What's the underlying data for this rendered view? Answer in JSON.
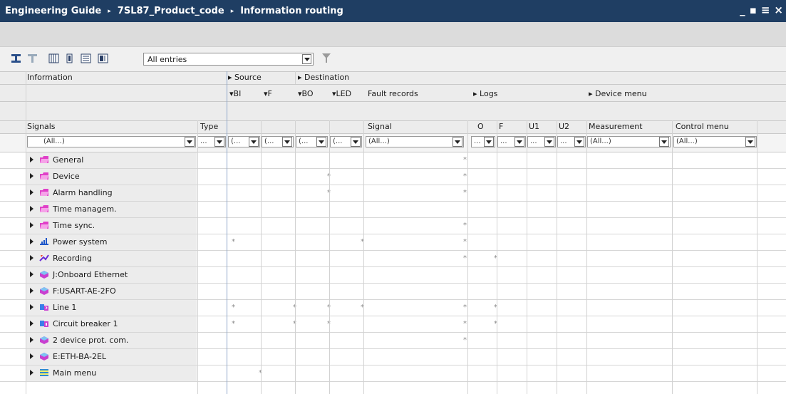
{
  "titlebar": {
    "crumbs": [
      "Engineering Guide",
      "7SL87_Product_code",
      "Information routing"
    ],
    "separator": "▸",
    "controls": [
      "_",
      "▪",
      "≡",
      "×"
    ]
  },
  "toolbar": {
    "buttons": [
      "insert-row-icon",
      "expand-icon",
      "columns-icon",
      "column-icon",
      "list-icon",
      "split-icon"
    ],
    "filter_value": "All entries",
    "filter_icon": "funnel-icon"
  },
  "header": {
    "information": "Information",
    "source": "Source",
    "destination": "Destination",
    "bi": "BI",
    "f": "F",
    "bo": "BO",
    "led": "LED",
    "fault_records": "Fault records",
    "logs": "Logs",
    "device_menu": "Device menu",
    "signals": "Signals",
    "type": "Type",
    "signal": "Signal",
    "o": "O",
    "f2": "F",
    "u1": "U1",
    "u2": "U2",
    "measurement": "Measurement",
    "control_menu": "Control menu"
  },
  "filters": {
    "signals": "(All...)",
    "type": "...",
    "bi": "(...",
    "f": "(...",
    "bo": "(...",
    "led": "(...",
    "signal": "(All...)",
    "o": "...",
    "f2": "...",
    "u1": "...",
    "u2": "...",
    "measurement": "(All...)",
    "control_menu": "(All...)"
  },
  "rows": [
    {
      "label": "General",
      "icon": "folder-pink-icon",
      "marks": {
        "o": "*"
      }
    },
    {
      "label": "Device",
      "icon": "folder-pink-icon",
      "marks": {
        "led": "*",
        "o": "*"
      }
    },
    {
      "label": "Alarm handling",
      "icon": "folder-pink-icon",
      "marks": {
        "led": "*",
        "o": "*"
      }
    },
    {
      "label": "Time managem.",
      "icon": "folder-pink-icon",
      "marks": {}
    },
    {
      "label": "Time sync.",
      "icon": "folder-pink-icon",
      "marks": {
        "o": "*"
      }
    },
    {
      "label": "Power system",
      "icon": "power-system-icon",
      "marks": {
        "bi": "*",
        "signal": "*",
        "o": "*"
      }
    },
    {
      "label": "Recording",
      "icon": "recording-icon",
      "marks": {
        "o": "*",
        "f2": "*"
      }
    },
    {
      "label": "J:Onboard Ethernet",
      "icon": "module-icon",
      "marks": {}
    },
    {
      "label": "F:USART-AE-2FO",
      "icon": "module-icon",
      "marks": {}
    },
    {
      "label": "Line 1",
      "icon": "line-icon",
      "marks": {
        "bi": "*",
        "bo": "*",
        "led": "*",
        "signal": "*",
        "o": "*",
        "f2": "*"
      }
    },
    {
      "label": "Circuit breaker 1",
      "icon": "breaker-icon",
      "marks": {
        "bi": "*",
        "bo": "*",
        "led": "*",
        "o": "*",
        "f2": "*"
      }
    },
    {
      "label": "2 device prot. com.",
      "icon": "module-icon",
      "marks": {
        "o": "*"
      }
    },
    {
      "label": "E:ETH-BA-2EL",
      "icon": "module-icon",
      "marks": {}
    },
    {
      "label": "Main menu",
      "icon": "menu-icon",
      "marks": {
        "f": "*"
      }
    }
  ]
}
